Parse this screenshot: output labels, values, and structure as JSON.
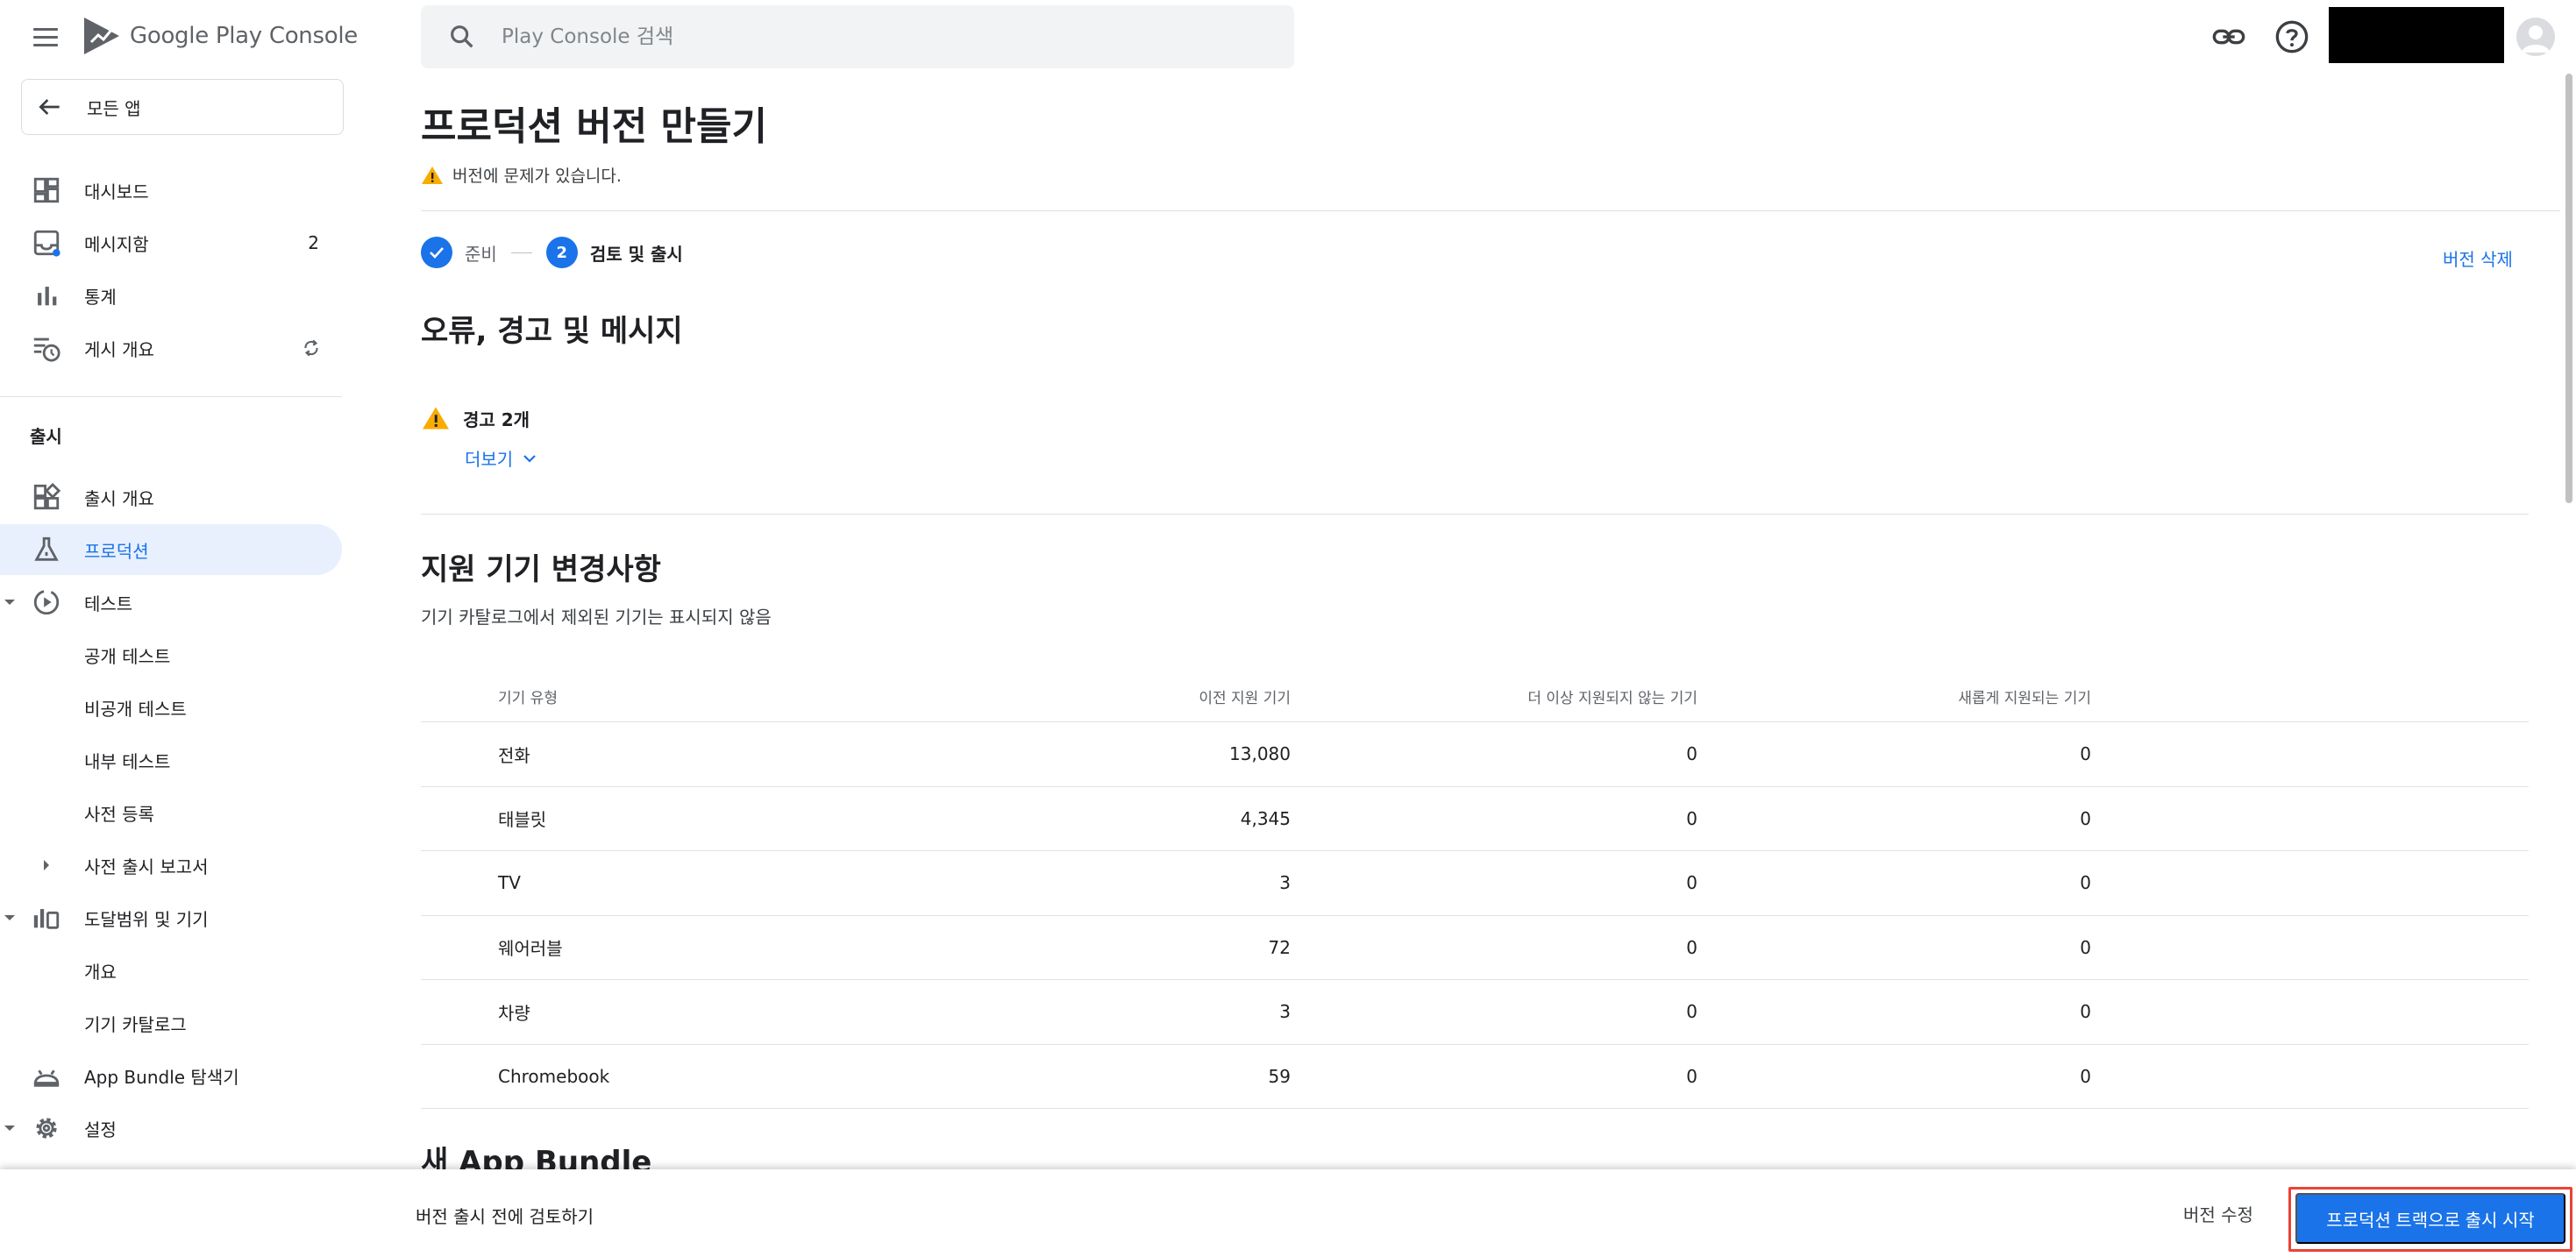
{
  "app": {
    "brand": "Google Play Console",
    "accent": "#1a73e8",
    "warning_color": "#f9ab00"
  },
  "search": {
    "placeholder": "Play Console 검색"
  },
  "sidebar": {
    "back_label": "모든 앱",
    "items": [
      {
        "label": "대시보드",
        "icon": "dashboard-icon"
      },
      {
        "label": "메시지함",
        "icon": "inbox-icon",
        "count": "2"
      },
      {
        "label": "통계",
        "icon": "bar-chart-icon"
      },
      {
        "label": "게시 개요",
        "icon": "publishing-overview-icon"
      }
    ],
    "section_release": "출시",
    "release_items": [
      {
        "label": "출시 개요"
      },
      {
        "label": "프로덕션"
      },
      {
        "label": "테스트"
      },
      {
        "label": "공개 테스트"
      },
      {
        "label": "비공개 테스트"
      },
      {
        "label": "내부 테스트"
      },
      {
        "label": "사전 등록"
      },
      {
        "label": "사전 출시 보고서"
      },
      {
        "label": "도달범위 및 기기"
      },
      {
        "label": "개요"
      },
      {
        "label": "기기 카탈로그"
      },
      {
        "label": "App Bundle 탐색기"
      },
      {
        "label": "설정"
      }
    ]
  },
  "main": {
    "title": "프로덕션 버전 만들기",
    "release_warning": "버전에 문제가 있습니다.",
    "steps": [
      {
        "label": "준비",
        "state": "done"
      },
      {
        "number": "2",
        "label": "검토 및 출시",
        "state": "current"
      }
    ],
    "delete_label": "버전 삭제",
    "errors_title": "오류, 경고 및 메시지",
    "warnings_count_label": "경고 2개",
    "more_label": "더보기",
    "devices_title": "지원 기기 변경사항",
    "devices_subtitle": "기기 카탈로그에서 제외된 기기는 표시되지 않음",
    "table": {
      "headers": [
        "기기 유형",
        "이전 지원 기기",
        "더 이상 지원되지 않는 기기",
        "새롭게 지원되는 기기"
      ],
      "rows": [
        [
          "전화",
          "13,080",
          "0",
          "0"
        ],
        [
          "태블릿",
          "4,345",
          "0",
          "0"
        ],
        [
          "TV",
          "3",
          "0",
          "0"
        ],
        [
          "웨어러블",
          "72",
          "0",
          "0"
        ],
        [
          "차량",
          "3",
          "0",
          "0"
        ],
        [
          "Chromebook",
          "59",
          "0",
          "0"
        ]
      ]
    },
    "new_bundle_title": "새 App Bundle"
  },
  "bottom": {
    "message": "버전 출시 전에 검토하기",
    "edit_label": "버전 수정",
    "start_label": "프로덕션 트랙으로 출시 시작"
  }
}
